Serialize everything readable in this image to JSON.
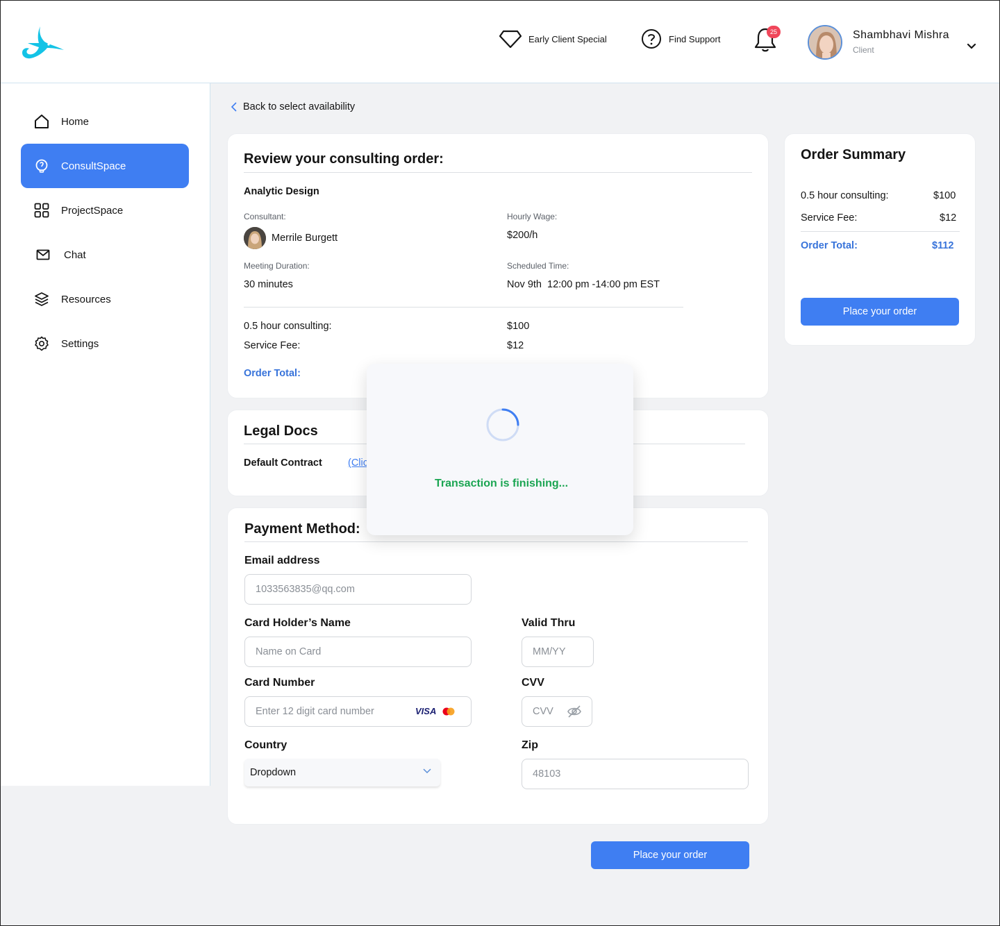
{
  "header": {
    "promo_label": "Early Client Special",
    "support_label": "Find Support",
    "notification_count": "25",
    "user_name": "Shambhavi Mishra",
    "user_role": "Client"
  },
  "sidebar": {
    "items": [
      {
        "label": "Home",
        "icon": "home-icon"
      },
      {
        "label": "ConsultSpace",
        "icon": "lightbulb-icon",
        "active": true
      },
      {
        "label": "ProjectSpace",
        "icon": "grid-icon"
      },
      {
        "label": "Chat",
        "icon": "mail-icon"
      },
      {
        "label": "Resources",
        "icon": "layers-icon"
      },
      {
        "label": "Settings",
        "icon": "gear-icon"
      }
    ]
  },
  "back_link": "Back to select availability",
  "review": {
    "title": "Review your consulting order:",
    "project_name": "Analytic Design",
    "consultant_label": "Consultant:",
    "consultant_name": "Merrile Burgett",
    "wage_label": "Hourly Wage:",
    "wage_value": "$200/h",
    "duration_label": "Meeting Duration:",
    "duration_value": "30 minutes",
    "time_label": "Scheduled Time:",
    "time_value": "Nov 9th  12:00 pm -14:00 pm EST",
    "line1_label": "0.5 hour consulting:",
    "line1_value": "$100",
    "line2_label": "Service Fee:",
    "line2_value": "$12",
    "total_label": "Order Total:"
  },
  "legal": {
    "title": "Legal Docs",
    "contract_label": "Default Contract",
    "contract_link": "(Clic"
  },
  "payment": {
    "title": "Payment Method:",
    "email_label": "Email address",
    "email_placeholder": "1033563835@qq.com",
    "holder_label": "Card Holder’s Name",
    "holder_placeholder": "Name on Card",
    "valid_label": "Valid Thru",
    "valid_placeholder": "MM/YY",
    "number_label": "Card Number",
    "number_placeholder": "Enter 12 digit card number",
    "visa_text": "VISA",
    "cvv_label": "CVV",
    "cvv_placeholder": "CVV",
    "country_label": "Country",
    "country_value": "Dropdown",
    "zip_label": "Zip",
    "zip_placeholder": "48103"
  },
  "summary": {
    "title": "Order Summary",
    "line1_label": "0.5 hour consulting:",
    "line1_value": "$100",
    "line2_label": "Service Fee:",
    "line2_value": "$12",
    "total_label": "Order Total:",
    "total_value": "$112",
    "button_label": "Place your order"
  },
  "bottom_button_label": "Place your order",
  "modal": {
    "message": "Transaction is finishing..."
  },
  "colors": {
    "accent": "#3f7ef2",
    "success": "#1ba552",
    "badge": "#f0465a",
    "logo": "#14c3e6"
  }
}
